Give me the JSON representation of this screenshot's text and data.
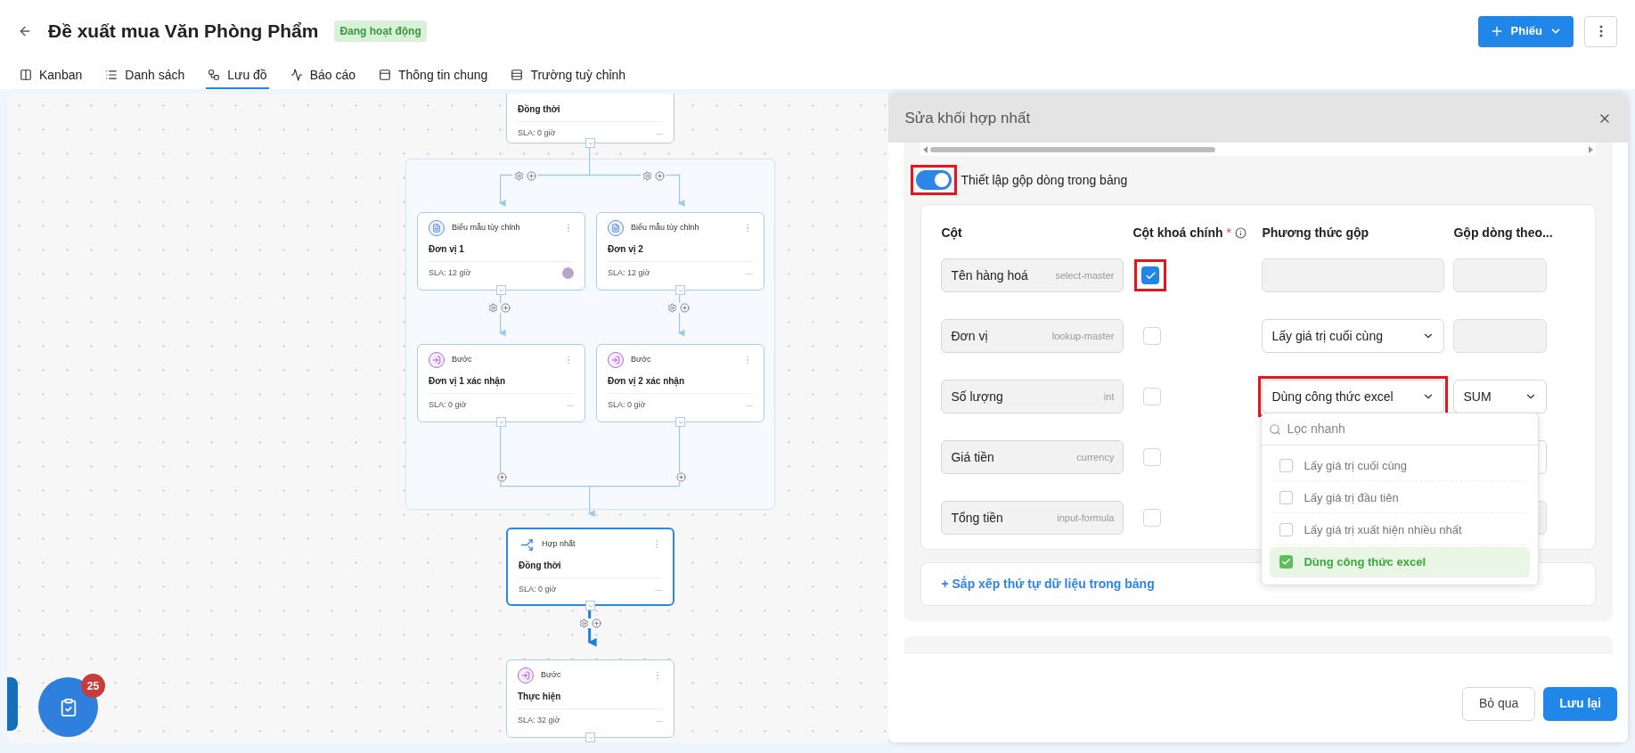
{
  "header": {
    "title": "Đề xuất mua Văn Phòng Phẩm",
    "status": "Đang hoạt động",
    "new_button": "Phiếu"
  },
  "tabs": [
    {
      "label": "Kanban",
      "selected": false
    },
    {
      "label": "Danh sách",
      "selected": false
    },
    {
      "label": "Lưu đồ",
      "selected": true
    },
    {
      "label": "Báo cáo",
      "selected": false
    },
    {
      "label": "Thông tin chung",
      "selected": false
    },
    {
      "label": "Trường tuỳ chỉnh",
      "selected": false
    }
  ],
  "flow": {
    "nodes": [
      {
        "title": "Đồng thời",
        "sla": "SLA: 0 giờ",
        "assignee": "—",
        "selected": false
      },
      {
        "kind": "form",
        "type": "Biểu mẫu tùy chỉnh",
        "title": "Đơn vị 1",
        "sla": "SLA: 12 giờ",
        "avatar": true,
        "selected": false
      },
      {
        "kind": "form",
        "type": "Biểu mẫu tùy chỉnh",
        "title": "Đơn vị 2",
        "sla": "SLA: 12 giờ",
        "assignee": "—",
        "selected": false
      },
      {
        "kind": "step",
        "type": "Bước",
        "title": "Đơn vị 1 xác nhận",
        "sla": "SLA: 0 giờ",
        "assignee": "—",
        "selected": false
      },
      {
        "kind": "step",
        "type": "Bước",
        "title": "Đơn vị 2 xác nhận",
        "sla": "SLA: 0 giờ",
        "assignee": "—",
        "selected": false
      },
      {
        "kind": "merge",
        "type": "Hợp nhất",
        "title": "Đồng thời",
        "sla": "SLA: 0 giờ",
        "assignee": "—",
        "selected": true
      },
      {
        "kind": "step",
        "type": "Bước",
        "title": "Thực hiện",
        "sla": "SLA: 32 giờ",
        "assignee": "—",
        "selected": false
      }
    ]
  },
  "fab": {
    "badge": "25"
  },
  "panel": {
    "title": "Sửa khối hợp nhất",
    "merge_toggle": {
      "label": "Thiết lập gộp dòng trong bảng",
      "on": true,
      "highlighted": true
    },
    "columns": [
      {
        "label": "Cột"
      },
      {
        "label": "Cột khoá chính",
        "required_mark": "*",
        "info": true
      },
      {
        "label": "Phương thức gộp"
      },
      {
        "label": "Gộp dòng theo..."
      }
    ],
    "rows": [
      {
        "name": "Tên hàng hoá",
        "type": "select-master",
        "key": true,
        "key_highlighted": true,
        "method": {
          "kind": "disabled"
        },
        "group_by": {
          "kind": "disabled"
        }
      },
      {
        "name": "Đơn vị",
        "type": "lookup-master",
        "key": false,
        "method": {
          "kind": "select",
          "value": "Lấy giá trị cuối cùng"
        },
        "group_by": {
          "kind": "disabled"
        }
      },
      {
        "name": "Số lượng",
        "type": "int",
        "key": false,
        "method": {
          "kind": "select",
          "value": "Dùng công thức excel",
          "highlighted": true
        },
        "group_by": {
          "kind": "select",
          "value": "SUM"
        }
      },
      {
        "name": "Giá tiền",
        "type": "currency",
        "key": false,
        "group_by": {
          "kind": "select"
        }
      },
      {
        "name": "Tổng tiền",
        "type": "input-formula",
        "key": false,
        "group_by": {
          "kind": "disabled"
        }
      }
    ],
    "dropdown": {
      "placeholder": "Lọc nhanh",
      "options": [
        {
          "label": "Lấy giá trị cuối cùng",
          "selected": false
        },
        {
          "label": "Lấy giá trị đầu tiên",
          "selected": false
        },
        {
          "label": "Lấy giá trị xuất hiện nhiều nhất",
          "selected": false
        },
        {
          "label": "Dùng công thức excel",
          "selected": true
        }
      ]
    },
    "sort_link": "+ Sắp xếp thứ tự dữ liệu trong bảng",
    "buttons": {
      "cancel": "Bỏ qua",
      "save": "Lưu lại"
    }
  }
}
